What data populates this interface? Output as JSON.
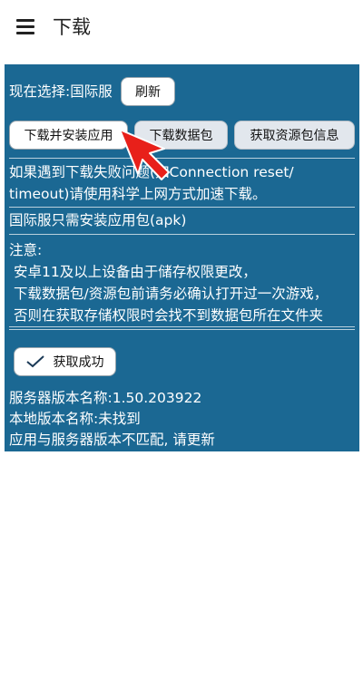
{
  "appbar": {
    "title": "下载",
    "menu_icon": "hamburger-menu-icon"
  },
  "selection": {
    "label": "现在选择:国际服",
    "refresh_label": "刷新"
  },
  "actions": {
    "download_install_label": "下载并安装应用",
    "download_data_label": "下载数据包",
    "fetch_info_label": "获取资源包信息"
  },
  "tips": {
    "network_line1": "如果遇到下载失败问题(如Connection reset/",
    "network_line2": "timeout)请使用科学上网方式加速下载。",
    "apk_only": "国际服只需安装应用包(apk)"
  },
  "notice": {
    "title": "注意:",
    "line1": "安卓11及以上设备由于储存权限更改，",
    "line2": "下载数据包/资源包前请务必确认打开过一次游戏，",
    "line3": "否则在获取存储权限时会找不到数据包所在文件夹"
  },
  "status": {
    "fetch_status_label": "获取成功",
    "check_icon": "check-icon"
  },
  "versions": {
    "server_version": "服务器版本名称:1.50.203922",
    "local_version": "本地版本名称:未找到",
    "mismatch": "应用与服务器版本不匹配, 请更新"
  },
  "colors": {
    "panel_background": "#1b6893",
    "pointer_arrow": "#e8201a"
  }
}
